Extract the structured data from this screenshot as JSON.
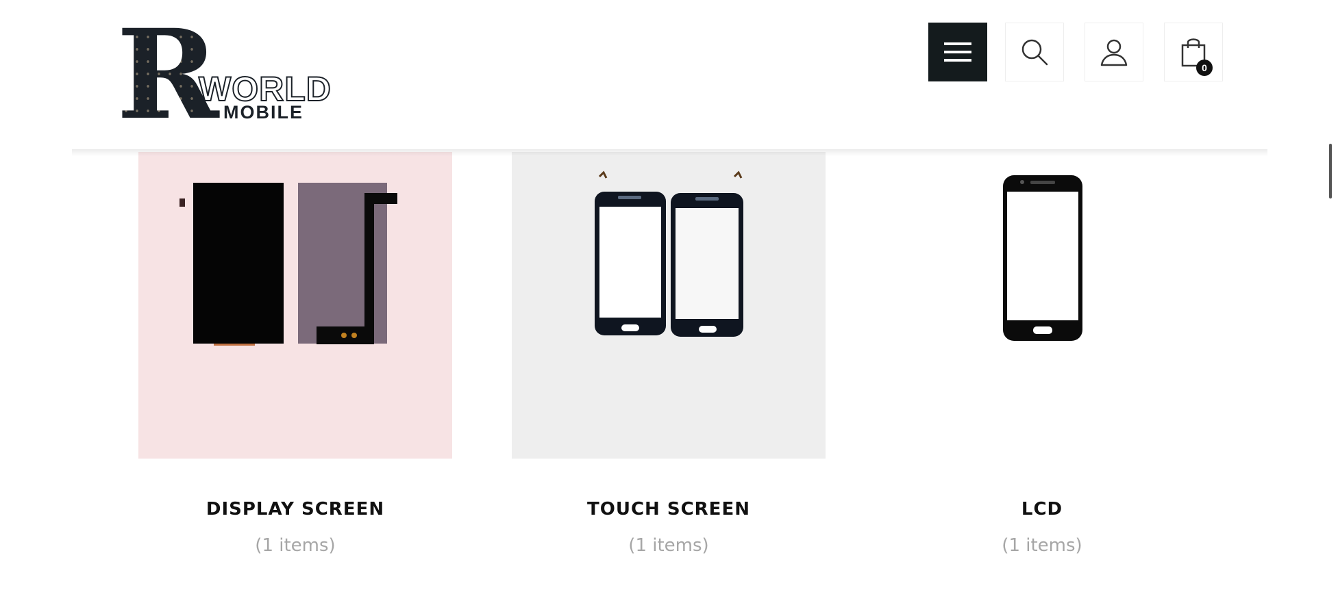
{
  "brand": {
    "logo_letter": "R",
    "logo_word": "WORLD",
    "logo_sub": "MOBILE"
  },
  "header": {
    "icons": [
      "menu-icon",
      "search-icon",
      "account-icon",
      "shopping-bag-icon"
    ],
    "cart_count": "0",
    "menu_button_color": "#141b1d"
  },
  "categories": [
    {
      "name": "DISPLAY SCREEN",
      "count": "(1 items)",
      "background": "#f7e3e4"
    },
    {
      "name": "TOUCH SCREEN",
      "count": "(1 items)",
      "background": "#eeeeee"
    },
    {
      "name": "LCD",
      "count": "(1 items)",
      "background": "#ffffff"
    }
  ]
}
